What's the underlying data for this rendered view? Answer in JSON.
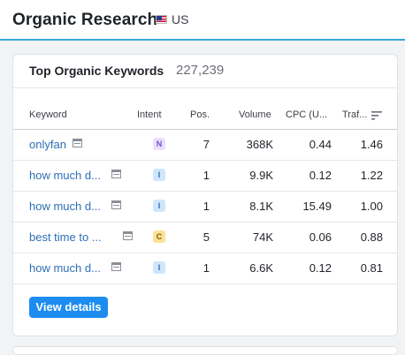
{
  "header": {
    "title": "Organic Research",
    "country": "US"
  },
  "card": {
    "title": "Top Organic Keywords",
    "count": "227,239",
    "columns": {
      "keyword": "Keyword",
      "intent": "Intent",
      "pos": "Pos.",
      "volume": "Volume",
      "cpc": "CPC (U...",
      "traffic": "Traf..."
    },
    "rows": [
      {
        "keyword": "onlyfan",
        "intent": "N",
        "pos": "7",
        "volume": "368K",
        "cpc": "0.44",
        "traffic": "1.46"
      },
      {
        "keyword": "how much d...",
        "intent": "I",
        "pos": "1",
        "volume": "9.9K",
        "cpc": "0.12",
        "traffic": "1.22"
      },
      {
        "keyword": "how much d...",
        "intent": "I",
        "pos": "1",
        "volume": "8.1K",
        "cpc": "15.49",
        "traffic": "1.00"
      },
      {
        "keyword": "best time to ...",
        "intent": "C",
        "pos": "5",
        "volume": "74K",
        "cpc": "0.06",
        "traffic": "0.88"
      },
      {
        "keyword": "how much d...",
        "intent": "I",
        "pos": "1",
        "volume": "6.6K",
        "cpc": "0.12",
        "traffic": "0.81"
      }
    ],
    "button_label": "View details"
  },
  "intent_colors": {
    "N": {
      "bg": "#e9e0fb",
      "fg": "#7a4fd1"
    },
    "I": {
      "bg": "#cfe6fb",
      "fg": "#2d6fb6"
    },
    "C": {
      "bg": "#fbe29a",
      "fg": "#8a5d00"
    }
  },
  "icons": {
    "flag": "us-flag-icon",
    "serp": "serp-features-icon",
    "sort": "sort-icon"
  }
}
